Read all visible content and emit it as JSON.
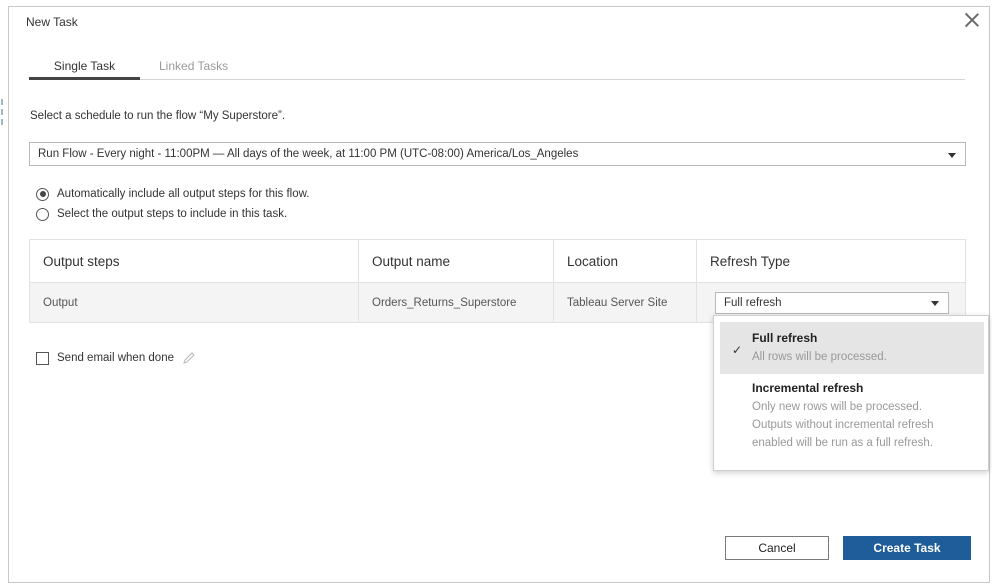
{
  "dialog": {
    "title": "New Task"
  },
  "tabs": [
    {
      "label": "Single Task",
      "active": true
    },
    {
      "label": "Linked Tasks",
      "active": false
    }
  ],
  "instruction": "Select a schedule to run the flow “My Superstore”.",
  "schedule_select": {
    "value": "Run Flow - Every night - 11:00PM — All days of the week, at 11:00 PM (UTC-08:00) America/Los_Angeles"
  },
  "radios": [
    {
      "label": "Automatically include all output steps for this flow.",
      "checked": true
    },
    {
      "label": "Select the output steps to include in this task.",
      "checked": false
    }
  ],
  "table": {
    "headers": [
      "Output steps",
      "Output name",
      "Location",
      "Refresh Type"
    ],
    "rows": [
      {
        "step": "Output",
        "name": "Orders_Returns_Superstore",
        "location": "Tableau Server Site",
        "refresh": "Full refresh"
      }
    ]
  },
  "email": {
    "label": "Send email when done",
    "checked": false
  },
  "refresh_dropdown": {
    "options": [
      {
        "title": "Full refresh",
        "desc": [
          "All rows will be processed."
        ],
        "selected": true
      },
      {
        "title": "Incremental refresh",
        "desc": [
          "Only new rows will be processed.",
          "Outputs without incremental refresh",
          "enabled will be run as a full refresh."
        ],
        "selected": false
      }
    ],
    "check_glyph": "✓"
  },
  "buttons": {
    "cancel": "Cancel",
    "create": "Create Task"
  },
  "colors": {
    "primary": "#1f5d9a",
    "selected_option_bg": "#e5e5e5"
  },
  "icons": {
    "close": "close-icon",
    "caret": "chevron-down-icon",
    "pencil": "pencil-icon",
    "check": "check-icon"
  }
}
